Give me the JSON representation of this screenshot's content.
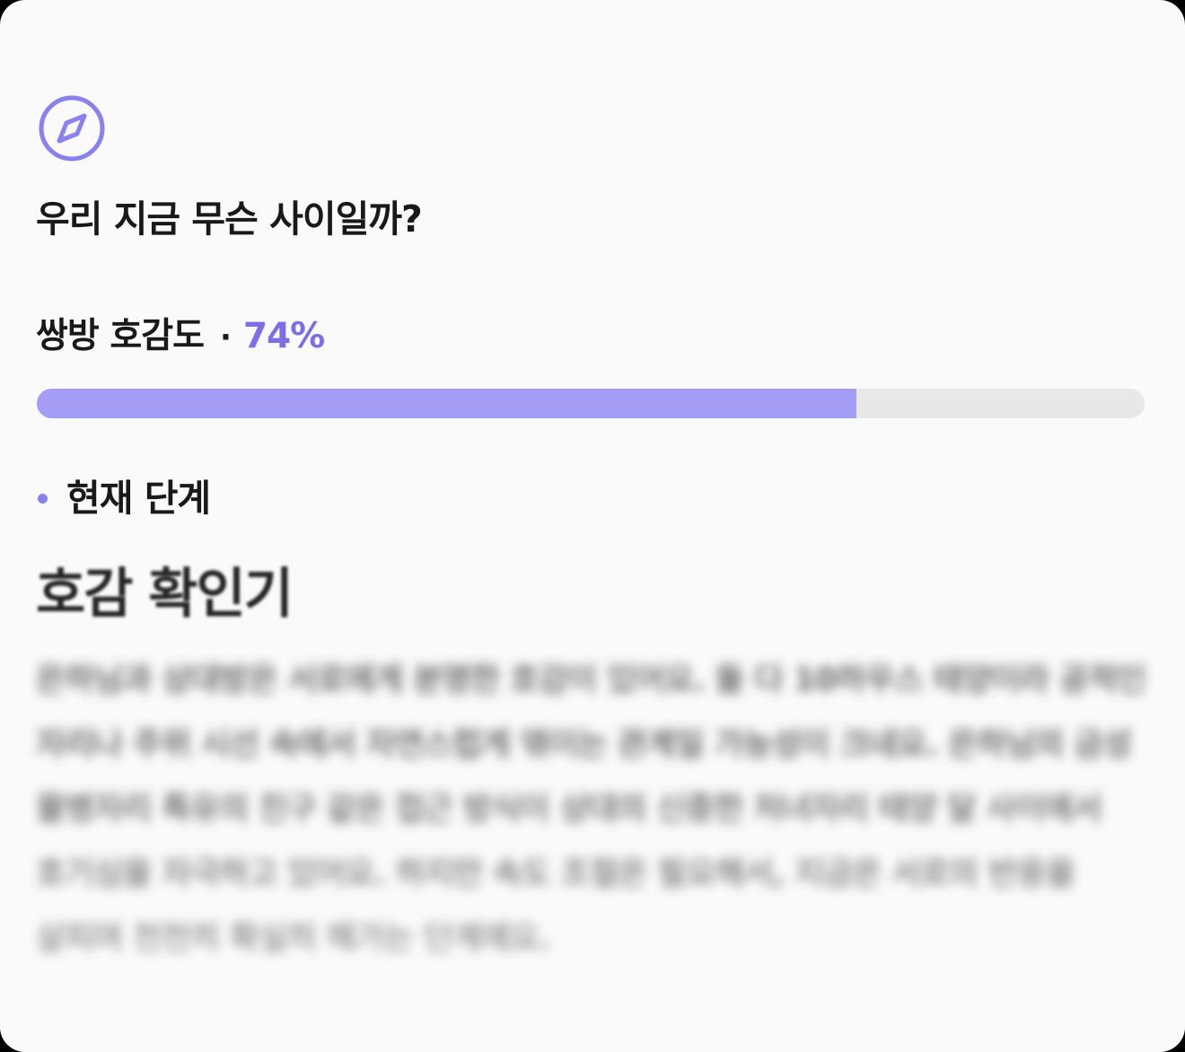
{
  "card": {
    "title": "우리 지금 무슨 사이일까?",
    "metric_label": "쌍방 호감도",
    "metric_separator": "·",
    "metric_value": "74%",
    "progress_percent": 74,
    "stage_label": "현재 단계",
    "stage_name": "호감 확인기",
    "description": "은하님과 상대방은 서로에게 분명한 호감이 있어요. 둘 다 10하우스 태양이라 공적인 자리나 주위 시선 속에서 자연스럽게 엮이는 관계일 가능성이 크네요. 은하님의 금성 물병자리 특유의 친구 같은 접근 방식이 상대의 신중한 처녀자리 태양 달 사이에서 호기심을 자극하고 있어요. 하지만 속도 조절은 필요해서, 지금은 서로의 반응을 살피며 천천히 확실히 해가는 단계예요.",
    "colors": {
      "accent": "#7b6ee8",
      "progress_fill": "#a59df5",
      "progress_track": "#e8e8e8",
      "stage_dot": "#8a80ee"
    },
    "icon": "compass-icon"
  }
}
